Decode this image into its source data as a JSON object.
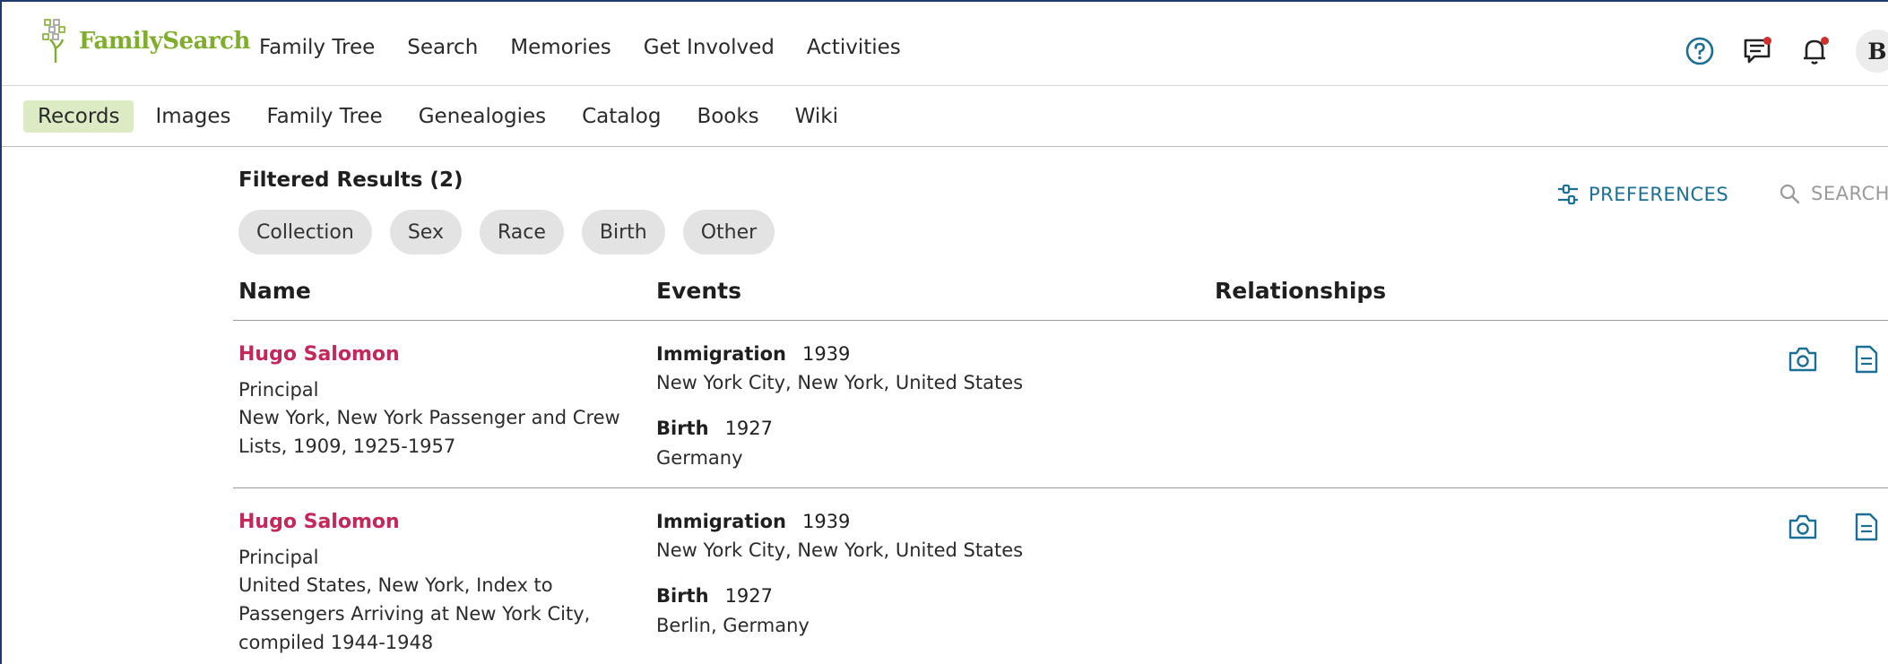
{
  "header": {
    "logo_text": "FamilySearch",
    "nav": [
      "Family Tree",
      "Search",
      "Memories",
      "Get Involved",
      "Activities"
    ],
    "avatar_initial": "B"
  },
  "subnav": {
    "items": [
      "Records",
      "Images",
      "Family Tree",
      "Genealogies",
      "Catalog",
      "Books",
      "Wiki"
    ],
    "active": "Records"
  },
  "results": {
    "title": "Filtered Results (2)",
    "chips": [
      "Collection",
      "Sex",
      "Race",
      "Birth",
      "Other"
    ],
    "preferences_label": "PREFERENCES",
    "search_label": "SEARCH",
    "columns": {
      "name": "Name",
      "events": "Events",
      "relationships": "Relationships"
    },
    "rows": [
      {
        "name": "Hugo Salomon",
        "role": "Principal",
        "collection": "New York, New York Passenger and Crew Lists, 1909, 1925-1957",
        "events": [
          {
            "type": "Immigration",
            "year": "1939",
            "place": "New York City, New York, United States"
          },
          {
            "type": "Birth",
            "year": "1927",
            "place": "Germany"
          }
        ]
      },
      {
        "name": "Hugo Salomon",
        "role": "Principal",
        "collection": "United States, New York, Index to Passengers Arriving at New York City, compiled 1944-1948",
        "events": [
          {
            "type": "Immigration",
            "year": "1939",
            "place": "New York City, New York, United States"
          },
          {
            "type": "Birth",
            "year": "1927",
            "place": "Berlin, Germany"
          }
        ]
      }
    ]
  },
  "colors": {
    "brand_green": "#7fae2c",
    "name_link": "#c4285a",
    "accent_blue": "#1b6e95",
    "active_tab_bg": "#dcebc4",
    "notification_dot": "#d0312d"
  },
  "icons": [
    "help-icon",
    "messages-icon",
    "notifications-icon",
    "preferences-icon",
    "search-icon",
    "camera-icon",
    "document-icon"
  ]
}
